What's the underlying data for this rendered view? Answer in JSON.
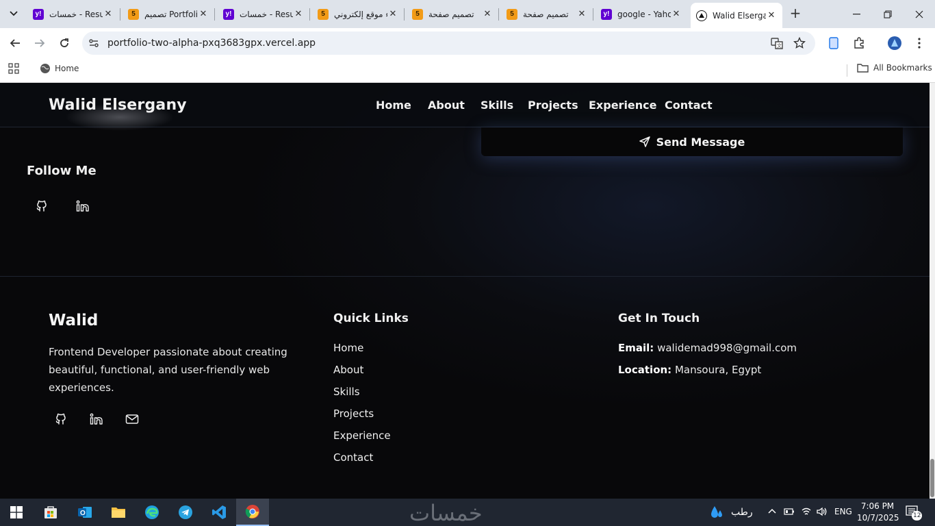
{
  "browser": {
    "tabs": [
      {
        "title": "خمسات - Results",
        "favicon": "yahoo-favicon",
        "active": false
      },
      {
        "title": "تصميم Portfolio",
        "favicon": "h5-favicon",
        "active": false
      },
      {
        "title": "خمسات - Results",
        "favicon": "yahoo-favicon",
        "active": false
      },
      {
        "title": "إنشاء موقع إلكتروني",
        "favicon": "h5-favicon",
        "active": false
      },
      {
        "title": "تصميم صفحة",
        "favicon": "h5-favicon",
        "active": false
      },
      {
        "title": "تصميم صفحة",
        "favicon": "h5-favicon",
        "active": false
      },
      {
        "title": "google - Yahoo",
        "favicon": "yahoo-favicon",
        "active": false
      },
      {
        "title": "Walid Elsergany",
        "favicon": "vercel-favicon",
        "active": true
      }
    ],
    "url": "portfolio-two-alpha-pxq3683gpx.vercel.app",
    "bookmarks": {
      "home": "Home",
      "all": "All Bookmarks"
    }
  },
  "site": {
    "logo": "Walid Elsergany",
    "nav": [
      "Home",
      "About",
      "Skills",
      "Projects",
      "Experience",
      "Contact"
    ],
    "send_button": "Send Message",
    "follow_title": "Follow Me"
  },
  "footer": {
    "brand": "Walid",
    "description": "Frontend Developer passionate about creating beautiful, functional, and user-friendly web experiences.",
    "quick_links_title": "Quick Links",
    "quick_links": [
      "Home",
      "About",
      "Skills",
      "Projects",
      "Experience",
      "Contact"
    ],
    "get_in_touch_title": "Get In Touch",
    "email_label": "Email:",
    "email": "walidemad998@gmail.com",
    "location_label": "Location:",
    "location": "Mansoura, Egypt"
  },
  "taskbar": {
    "watermark": "خمسات",
    "weather": "رطب",
    "lang": "ENG",
    "time": "7:06 PM",
    "date": "10/7/2025",
    "notifications": "12"
  },
  "colors": {
    "page_bg": "#0a0a0b",
    "accent_glow": "#506eb4",
    "text": "#f0f0f0"
  }
}
